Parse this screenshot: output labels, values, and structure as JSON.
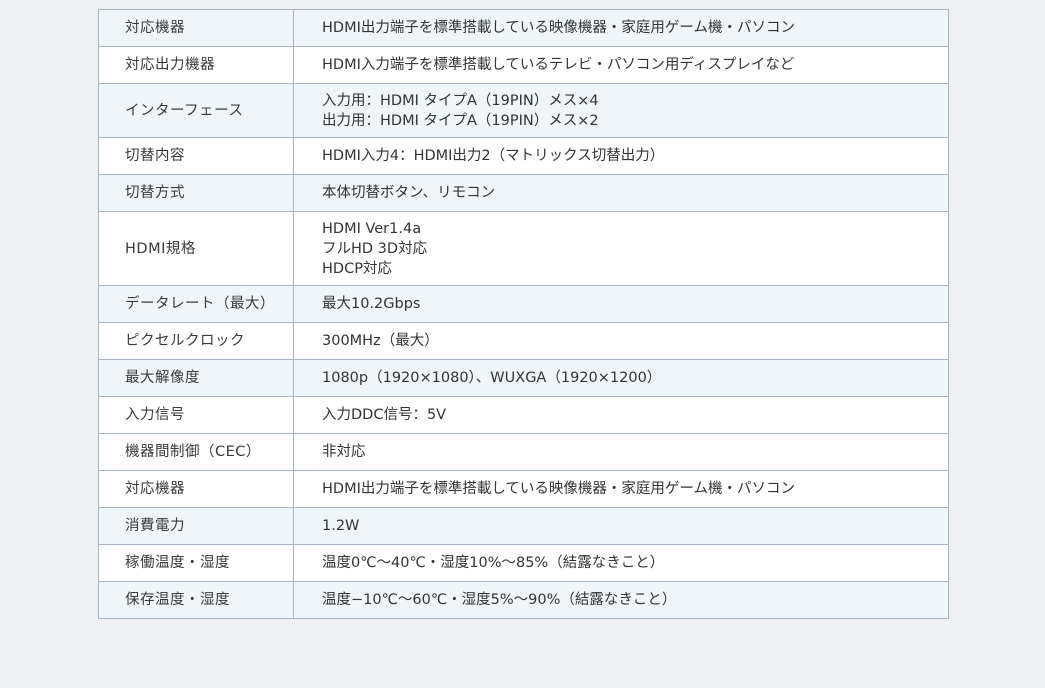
{
  "spec_table": {
    "rows": [
      {
        "label": "対応機器",
        "lines": [
          "HDMI出力端子を標準搭載している映像機器・家庭用ゲーム機・パソコン"
        ]
      },
      {
        "label": "対応出力機器",
        "lines": [
          "HDMI入力端子を標準搭載しているテレビ・パソコン用ディスプレイなど"
        ]
      },
      {
        "label": "インターフェース",
        "lines": [
          "入力用：HDMI タイプA（19PIN）メス×4",
          "出力用：HDMI タイプA（19PIN）メス×2"
        ]
      },
      {
        "label": "切替内容",
        "lines": [
          "HDMI入力4：HDMI出力2（マトリックス切替出力）"
        ]
      },
      {
        "label": "切替方式",
        "lines": [
          "本体切替ボタン、リモコン"
        ]
      },
      {
        "label": "HDMI規格",
        "lines": [
          "HDMI Ver1.4a",
          "フルHD 3D対応",
          "HDCP対応"
        ]
      },
      {
        "label": "データレート（最大）",
        "lines": [
          "最大10.2Gbps"
        ]
      },
      {
        "label": "ピクセルクロック",
        "lines": [
          "300MHz（最大）"
        ]
      },
      {
        "label": "最大解像度",
        "lines": [
          "1080p（1920×1080）、WUXGA（1920×1200）"
        ]
      },
      {
        "label": "入力信号",
        "lines": [
          "入力DDC信号：5V"
        ]
      },
      {
        "label": "機器間制御（CEC）",
        "lines": [
          "非対応"
        ]
      },
      {
        "label": "対応機器",
        "lines": [
          "HDMI出力端子を標準搭載している映像機器・家庭用ゲーム機・パソコン"
        ]
      },
      {
        "label": "消費電力",
        "lines": [
          "1.2W"
        ]
      },
      {
        "label": "稼働温度・湿度",
        "lines": [
          "温度0℃～40℃・湿度10%～85%（結露なきこと）"
        ]
      },
      {
        "label": "保存温度・湿度",
        "lines": [
          "温度−10℃～60℃・湿度5%～90%（結露なきこと）"
        ]
      }
    ]
  },
  "colors": {
    "page_background": "#eef0f4",
    "row_alt_background": "#eef6fc",
    "row_plain_background": "#ffffff",
    "border": "#a9b4c2",
    "text": "#333333"
  }
}
